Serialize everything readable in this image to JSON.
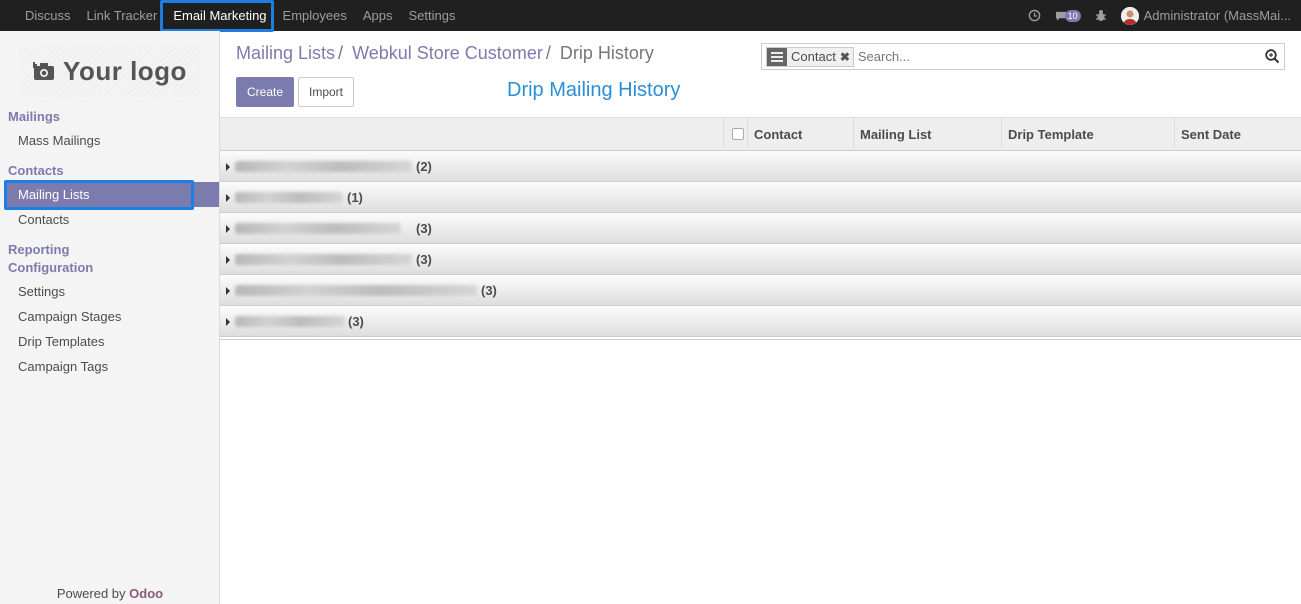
{
  "topbar": {
    "menu": [
      "Discuss",
      "Link Tracker",
      "Email Marketing",
      "Employees",
      "Apps",
      "Settings"
    ],
    "active_index": 2,
    "messages_badge": "10",
    "user_label": "Administrator (MassMai..."
  },
  "sidebar": {
    "logo_text": "Your logo",
    "sections": {
      "mailings": "Mailings",
      "mass_mailings": "Mass Mailings",
      "contacts": "Contacts",
      "mailing_lists": "Mailing Lists",
      "contacts_item": "Contacts",
      "reporting": "Reporting",
      "configuration": "Configuration",
      "settings": "Settings",
      "campaign_stages": "Campaign Stages",
      "drip_templates": "Drip Templates",
      "campaign_tags": "Campaign Tags"
    },
    "powered_prefix": "Powered by ",
    "powered_brand": "Odoo"
  },
  "breadcrumb": {
    "crumb1": "Mailing Lists",
    "crumb2": "Webkul Store Customer",
    "current": "Drip History"
  },
  "buttons": {
    "create": "Create",
    "import": "Import"
  },
  "view_title": "Drip Mailing History",
  "search": {
    "facet": "Contact",
    "placeholder": "Search..."
  },
  "table": {
    "columns": [
      "Contact",
      "Mailing List",
      "Drip Template",
      "Sent Date"
    ]
  },
  "groups": [
    {
      "count": "(2)"
    },
    {
      "count": "(1)"
    },
    {
      "count": "(3)"
    },
    {
      "count": "(3)"
    },
    {
      "count": "(3)"
    },
    {
      "count": "(3)"
    }
  ],
  "colors": {
    "accent": "#7c7bad",
    "title_blue": "#2a8fd5",
    "highlight": "#1e7fe0",
    "topbar": "#202020"
  }
}
